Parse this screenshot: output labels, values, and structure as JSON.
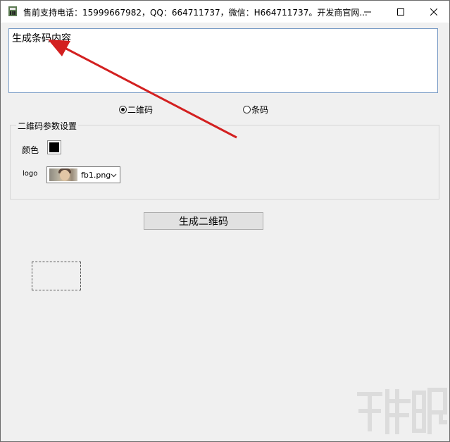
{
  "window": {
    "title": "售前支持电话：15999667982，QQ：664711737，微信：H664711737。开发商官网...",
    "controls": [
      "minimize-icon",
      "maximize-icon",
      "close-icon"
    ]
  },
  "content": {
    "text": "生成条码内容"
  },
  "mode": {
    "options": [
      {
        "label": "二维码",
        "selected": true
      },
      {
        "label": "条码",
        "selected": false
      }
    ]
  },
  "qr_settings": {
    "group_title": "二维码参数设置",
    "color_label": "颜色",
    "color_value": "#000000",
    "logo_label": "logo",
    "logo_file": "fb1.png"
  },
  "actions": {
    "generate_label": "生成二维码"
  },
  "colors": {
    "annotation_arrow": "#d32020",
    "textarea_border": "#7a9cc6"
  }
}
